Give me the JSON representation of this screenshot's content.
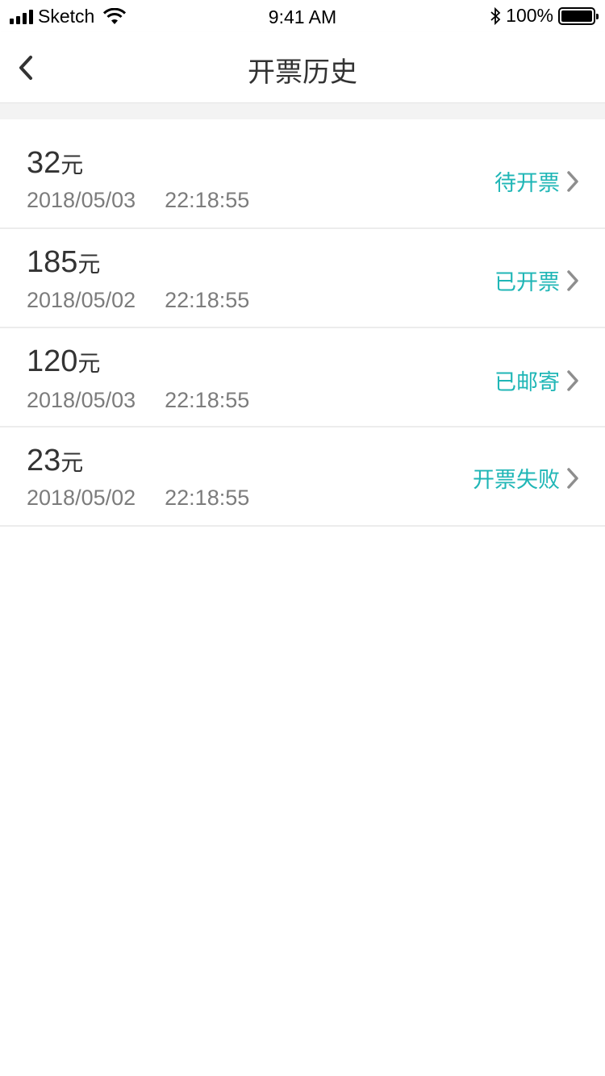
{
  "status_bar": {
    "carrier": "Sketch",
    "time": "9:41 AM",
    "battery": "100%"
  },
  "nav": {
    "title": "开票历史"
  },
  "colors": {
    "accent": "#1fb6b6",
    "text_primary": "#333333",
    "text_secondary": "#7c7c7c",
    "chevron": "#8e8e8e"
  },
  "invoices": [
    {
      "amount": "32",
      "unit": "元",
      "date": "2018/05/03",
      "time": "22:18:55",
      "status": "待开票"
    },
    {
      "amount": "185",
      "unit": "元",
      "date": "2018/05/02",
      "time": "22:18:55",
      "status": "已开票"
    },
    {
      "amount": "120",
      "unit": "元",
      "date": "2018/05/03",
      "time": "22:18:55",
      "status": "已邮寄"
    },
    {
      "amount": "23",
      "unit": "元",
      "date": "2018/05/02",
      "time": "22:18:55",
      "status": "开票失败"
    }
  ]
}
